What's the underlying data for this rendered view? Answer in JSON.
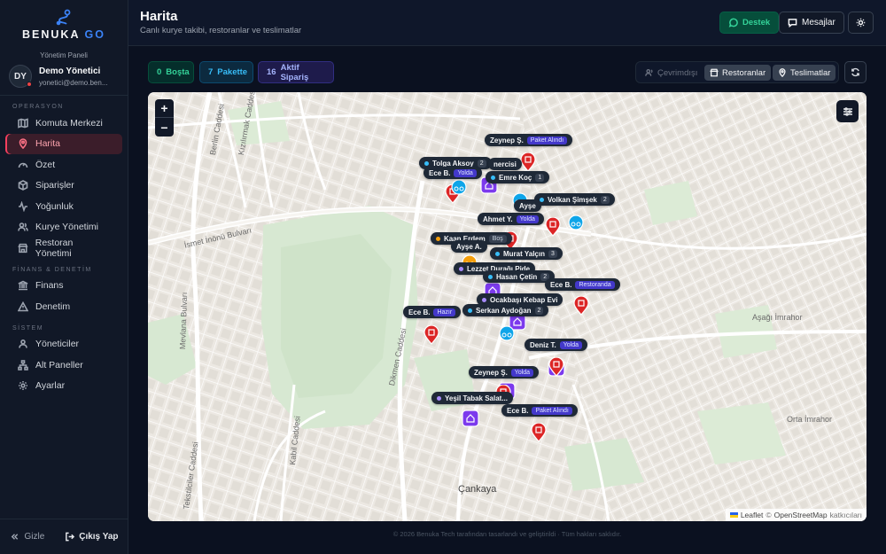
{
  "brand": {
    "name_main": "BENUKA",
    "name_accent": "GO",
    "panel_label": "Yönetim Paneli"
  },
  "user": {
    "initials": "DY",
    "name": "Demo Yönetici",
    "email": "yonetici@demo.ben..."
  },
  "sidebar": {
    "sections": [
      {
        "title": "OPERASYON",
        "items": [
          {
            "label": "Komuta Merkezi",
            "icon": "map-icon"
          },
          {
            "label": "Harita",
            "icon": "map-pin-icon",
            "active": true
          },
          {
            "label": "Özet",
            "icon": "gauge-icon"
          },
          {
            "label": "Siparişler",
            "icon": "box-icon"
          },
          {
            "label": "Yoğunluk",
            "icon": "activity-icon"
          },
          {
            "label": "Kurye Yönetimi",
            "icon": "users-icon"
          },
          {
            "label": "Restoran Yönetimi",
            "icon": "store-icon"
          }
        ]
      },
      {
        "title": "FİNANS & DENETİM",
        "items": [
          {
            "label": "Finans",
            "icon": "bank-icon"
          },
          {
            "label": "Denetim",
            "icon": "alert-triangle-icon"
          }
        ]
      },
      {
        "title": "SİSTEM",
        "items": [
          {
            "label": "Yöneticiler",
            "icon": "user-group-icon"
          },
          {
            "label": "Alt Paneller",
            "icon": "sitemap-icon"
          },
          {
            "label": "Ayarlar",
            "icon": "gear-icon"
          }
        ]
      }
    ],
    "collapse_label": "Gizle",
    "logout_label": "Çıkış Yap"
  },
  "header": {
    "title": "Harita",
    "subtitle": "Canlı kurye takibi, restoranlar ve teslimatlar",
    "support_label": "Destek",
    "messages_label": "Mesajlar"
  },
  "stats": {
    "idle": {
      "count": "0",
      "label": "Boşta"
    },
    "package": {
      "count": "7",
      "label": "Pakette"
    },
    "active": {
      "count": "16",
      "label": "Aktif Sipariş"
    }
  },
  "filters": {
    "online": "Çevrimdışı",
    "restaurants": "Restoranlar",
    "deliveries": "Teslimatlar"
  },
  "map": {
    "labels": {
      "ismet": "İsmet İnönü Bulvarı",
      "mevlana": "Mevlana Bulvarı",
      "dikmen": "Dikmen Caddesi",
      "cankaya": "Çankaya",
      "asagi": "Aşağı İmrahor",
      "orta": "Orta İmrahor",
      "kizilirmak": "Kızılırmak Caddesi",
      "kabil": "Kabil Caddesi",
      "tekstilciler": "Tekstilciler Caddesi",
      "berlin": "Berlin Caddesi"
    },
    "tags": [
      {
        "name": "Zeynep Ş.",
        "badge": "Paket Alındı"
      },
      {
        "name": "Tolga Aksoy",
        "count": "2"
      },
      {
        "name": "nercisi"
      },
      {
        "name": "Ece B.",
        "badge": "Yolda"
      },
      {
        "name": "Emre Koç",
        "count": "1"
      },
      {
        "name": "Volkan Şimşek",
        "count": "2"
      },
      {
        "name": "Ayşe"
      },
      {
        "name": "Ahmet Y.",
        "badge": "Yolda"
      },
      {
        "name": "Kaan Erdem",
        "badge": "Boş"
      },
      {
        "name": "Ayşe A."
      },
      {
        "name": "Murat Yalçın",
        "count": "3"
      },
      {
        "name": "Lezzet Durağı Pide"
      },
      {
        "name": "Hasan Çetin",
        "count": "2"
      },
      {
        "name": "Ece B.",
        "badge": "Restoranda"
      },
      {
        "name": "Ocakbaşı Kebap Evi"
      },
      {
        "name": "Serkan Aydoğan",
        "count": "2"
      },
      {
        "name": "Ece B.",
        "badge": "Hazır"
      },
      {
        "name": "Deniz T.",
        "badge": "Yolda"
      },
      {
        "name": "Zeynep Ş.",
        "badge": "Yolda"
      },
      {
        "name": "Yeşil Tabak Salat..."
      },
      {
        "name": "Ece B.",
        "badge": "Paket Alındı"
      }
    ],
    "attribution": {
      "leaflet": "Leaflet",
      "sep": "©",
      "osm": "OpenStreetMap",
      "rest": "katkıcıları"
    }
  },
  "footer": "© 2026 Benuka Tech tarafından tasarlandı ve geliştirildi · Tüm hakları saklıdır.",
  "colors": {
    "accent": "#3b82f6",
    "active": "#f43f5e",
    "restaurant": "#7c3aed",
    "delivery": "#dc2626",
    "courier": "#0ea5e9"
  }
}
